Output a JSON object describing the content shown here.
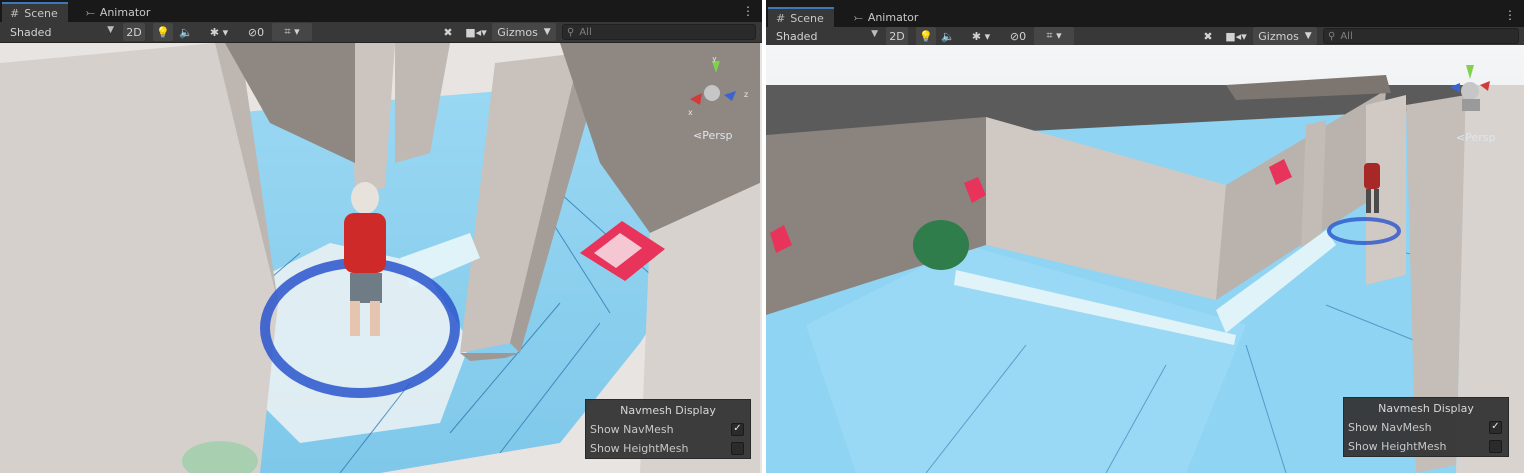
{
  "tabs": {
    "scene": "Scene",
    "animator": "Animator"
  },
  "left": {
    "shading_mode": "Shaded",
    "two_d": "2D",
    "fx_count": "0",
    "gizmos": "Gizmos",
    "search_placeholder": "All",
    "persp_label": "Persp",
    "navmesh": {
      "title": "Navmesh Display",
      "show_navmesh": "Show NavMesh",
      "show_heightmesh": "Show HeightMesh",
      "show_navmesh_checked": "✓",
      "show_heightmesh_checked": ""
    }
  },
  "right": {
    "shading_mode": "Shaded",
    "two_d": "2D",
    "fx_count": "0",
    "gizmos": "Gizmos",
    "search_placeholder": "All",
    "persp_label": "Persp",
    "navmesh": {
      "title": "Navmesh Display",
      "show_navmesh": "Show NavMesh",
      "show_heightmesh": "Show HeightMesh",
      "show_navmesh_checked": "✓",
      "show_heightmesh_checked": ""
    }
  },
  "gizmo_axes": {
    "x": "x",
    "y": "y",
    "z": "z"
  },
  "colors": {
    "navmesh": "#8fd4f2",
    "wall": "#cfc9c5",
    "tab_accent": "#3a79bb",
    "toolbar": "#383838",
    "goal_pink": "#e8335a",
    "agent_ring": "#2a55cc"
  }
}
